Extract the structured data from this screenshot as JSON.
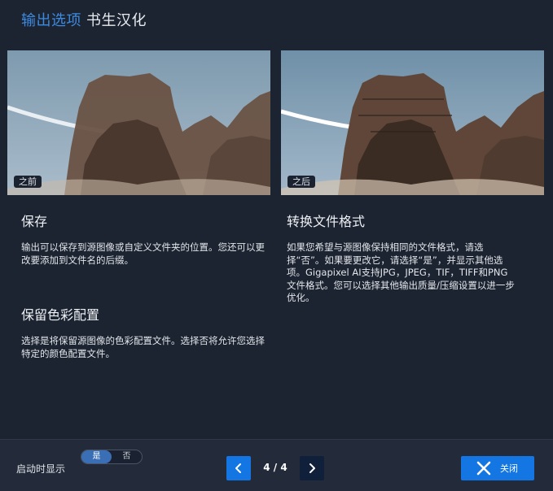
{
  "header": {
    "title": "输出选项",
    "subtitle": "书生汉化"
  },
  "images": {
    "before_label": "之前",
    "after_label": "之后"
  },
  "sections": {
    "save": {
      "title": "保存",
      "body": "输出可以保存到源图像或自定义文件夹的位置。您还可以更改要添加到文件名的后缀。"
    },
    "convert": {
      "title": "转换文件格式",
      "body": "如果您希望与源图像保持相同的文件格式，请选择“否”。如果要更改它，请选择“是”，并显示其他选项。Gigapixel AI支持JPG，JPEG，TIF，TIFF和PNG文件格式。您可以选择其他输出质量/压缩设置以进一步优化。"
    },
    "color": {
      "title": "保留色彩配置",
      "body": "选择是将保留源图像的色彩配置文件。选择否将允许您选择特定的颜色配置文件。"
    }
  },
  "footer": {
    "show_on_start_label": "启动时显示",
    "toggle_yes": "是",
    "toggle_no": "否",
    "page_indicator": "4 / 4",
    "close_label": "关闭"
  },
  "colors": {
    "background": "#1c2331",
    "accent": "#3d8be0",
    "button": "#1476e2"
  }
}
